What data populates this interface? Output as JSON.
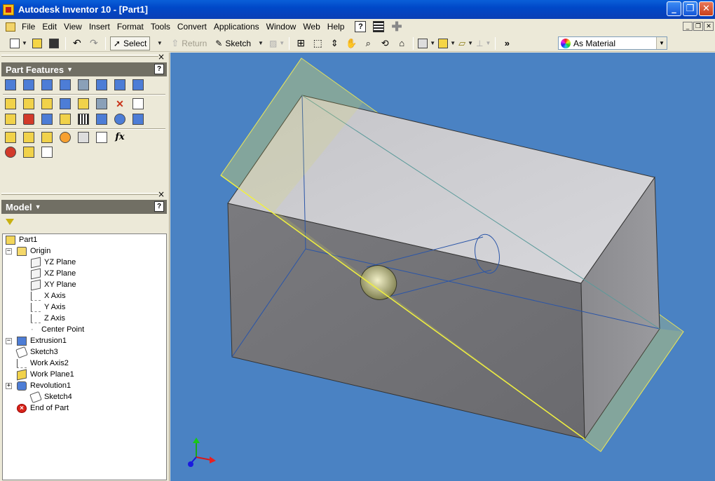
{
  "window": {
    "title": "Autodesk Inventor 10 - [Part1]",
    "buttons": [
      "_",
      "❐",
      "✕"
    ]
  },
  "menu": {
    "items": [
      "File",
      "Edit",
      "View",
      "Insert",
      "Format",
      "Tools",
      "Convert",
      "Applications",
      "Window",
      "Web",
      "Help"
    ],
    "help_glyph": "?",
    "mdi_buttons": [
      "_",
      "❐",
      "✕"
    ]
  },
  "toolbar": {
    "select_label": "Select",
    "return_label": "Return",
    "sketch_label": "Sketch",
    "material_value": "As Material"
  },
  "panel_features": {
    "title": "Part Features",
    "close_glyph": "×",
    "help_glyph": "?",
    "fx_label": "fx"
  },
  "panel_model": {
    "title": "Model",
    "close_glyph": "×",
    "help_glyph": "?"
  },
  "tree": {
    "items": [
      {
        "label": "Part1"
      },
      {
        "label": "Origin"
      },
      {
        "label": "YZ Plane"
      },
      {
        "label": "XZ Plane"
      },
      {
        "label": "XY Plane"
      },
      {
        "label": "X Axis"
      },
      {
        "label": "Y Axis"
      },
      {
        "label": "Z Axis"
      },
      {
        "label": "Center Point"
      },
      {
        "label": "Extrusion1"
      },
      {
        "label": "Sketch3"
      },
      {
        "label": "Work Axis2"
      },
      {
        "label": "Work Plane1"
      },
      {
        "label": "Revolution1"
      },
      {
        "label": "Sketch4"
      },
      {
        "label": "End of Part"
      }
    ],
    "expanders": [
      "−",
      "−",
      "+",
      "−"
    ]
  },
  "colors": {
    "viewport_bg": "#4a82c3",
    "panel_header_bg": "#716f64",
    "titlebar": "#0a4fd0"
  }
}
